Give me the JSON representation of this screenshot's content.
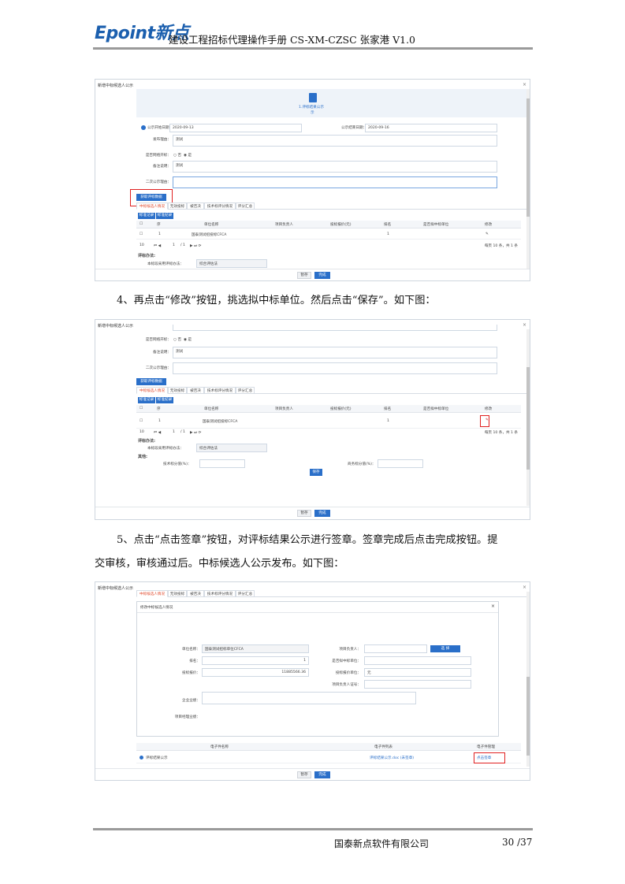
{
  "header": {
    "logo_text": "Epoint新点",
    "doc_title": "建设工程招标代理操作手册 CS-XM-CZSC 张家港 V1.0"
  },
  "shot1": {
    "dialog_title": "新增中标候选人公示",
    "close": "×",
    "step_label": "1.评标结果公示",
    "step_sub": "示",
    "fields": {
      "start_label": "公示开始日期：",
      "start_value": "2020-09-13",
      "end_label": "公示结束日期：",
      "end_value": "2020-09-16",
      "content_label": "发布理由：",
      "content_value": "测试",
      "second_label": "是否网络开标：",
      "radio_no": "否",
      "radio_yes": "是",
      "remark_label": "备注说明：",
      "remark_value": "测试",
      "reason_label": "二次公示理由："
    },
    "get_btn": "获取评标数据",
    "tabs": [
      "中标候选人情况",
      "无效投标",
      "被否决",
      "技术标评分情况",
      "评分汇总"
    ],
    "sub_btns": [
      "标准记录",
      "标准纪录"
    ],
    "columns": [
      "序",
      "单位名称",
      "项目负责人",
      "投标报价(元)",
      "排名",
      "是否拟中标单位",
      "修改"
    ],
    "row": [
      "1",
      "国泰测试招投标CFCA",
      "",
      "",
      "1",
      "",
      "✎"
    ],
    "pager": [
      "10",
      "1",
      "/ 1",
      "每页 10 条，共 1 条"
    ],
    "method_label": "评标办法:",
    "method_field_label": "本标段采用评标办法：",
    "method_field_value": "综合评估法",
    "btn_cancel": "暂存",
    "btn_done": "完成"
  },
  "para4": "4、再点击“修改”按钮，挑选拟中标单位。然后点击“保存”。如下图：",
  "shot2": {
    "dialog_title": "新增中标候选人公示",
    "close": "×",
    "fields": {
      "second_label": "是否网络开标：",
      "radio_no": "否",
      "radio_yes": "是",
      "remark_label": "备注说明：",
      "remark_value": "测试",
      "reason_label": "二次公示理由："
    },
    "get_btn": "获取评标数据",
    "tabs": [
      "中标候选人情况",
      "无效投标",
      "被否决",
      "技术标评分情况",
      "评分汇总"
    ],
    "sub_btns": [
      "标准记录",
      "标准纪录"
    ],
    "columns": [
      "序",
      "单位名称",
      "项目负责人",
      "投标报价(元)",
      "排名",
      "是否拟中标单位",
      "修改"
    ],
    "row": [
      "1",
      "国泰测试招投标CFCA",
      "",
      "",
      "1",
      "",
      "✎"
    ],
    "pager": [
      "10",
      "1",
      "/ 1",
      "每页 10 条，共 1 条"
    ],
    "method_label": "评标办法:",
    "method_field_label": "本标段采用评标办法：",
    "method_field_value": "综合评估法",
    "other_label": "其他:",
    "tech_label": "技术标分值(%)：",
    "biz_label": "商务标分值(%)：",
    "save_btn": "保存",
    "btn_cancel": "暂存",
    "btn_done": "完成"
  },
  "para5_line1": "5、点击“点击签章”按钮，对评标结果公示进行签章。签章完成后点击完成按钮。提",
  "para5_line2": "交审核，审核通过后。中标候选人公示发布。如下图：",
  "shot3": {
    "dialog_title": "新增中标候选人公示",
    "close": "×",
    "tabs": [
      "中标候选人情况",
      "无效投标",
      "被否决",
      "技术标评分情况",
      "评分汇总"
    ],
    "inner_title": "修改中标候选人情况",
    "inner_close": "×",
    "fields": {
      "unit_label": "单位名称：",
      "unit_value": "国泰测试招标单位CFCA",
      "pm_label": "项目负责人：",
      "pick_btn": "选 择",
      "rank_label": "排名：",
      "rank_value": "1",
      "win_label": "是否拟中标单位：",
      "price_label": "投标报价：",
      "price_value": "11885566.36",
      "bid_label": "投标报价单位：",
      "bid_value": "元",
      "cert_label": "项目负责人证号：",
      "qual_label": "企业业绩：",
      "proj_label": "项目经理业绩："
    },
    "file_head_name": "电子件名称",
    "file_head_list": "电子件列表",
    "file_head_mgr": "电子件管理",
    "file_name": "评标结果公示",
    "file_link": "评标结果公示.doc (未签章)",
    "sign_btn": "点击签章",
    "btn_cancel": "暂存",
    "btn_done": "完成"
  },
  "footer": {
    "company": "国泰新点软件有限公司",
    "page": "30 /37"
  }
}
